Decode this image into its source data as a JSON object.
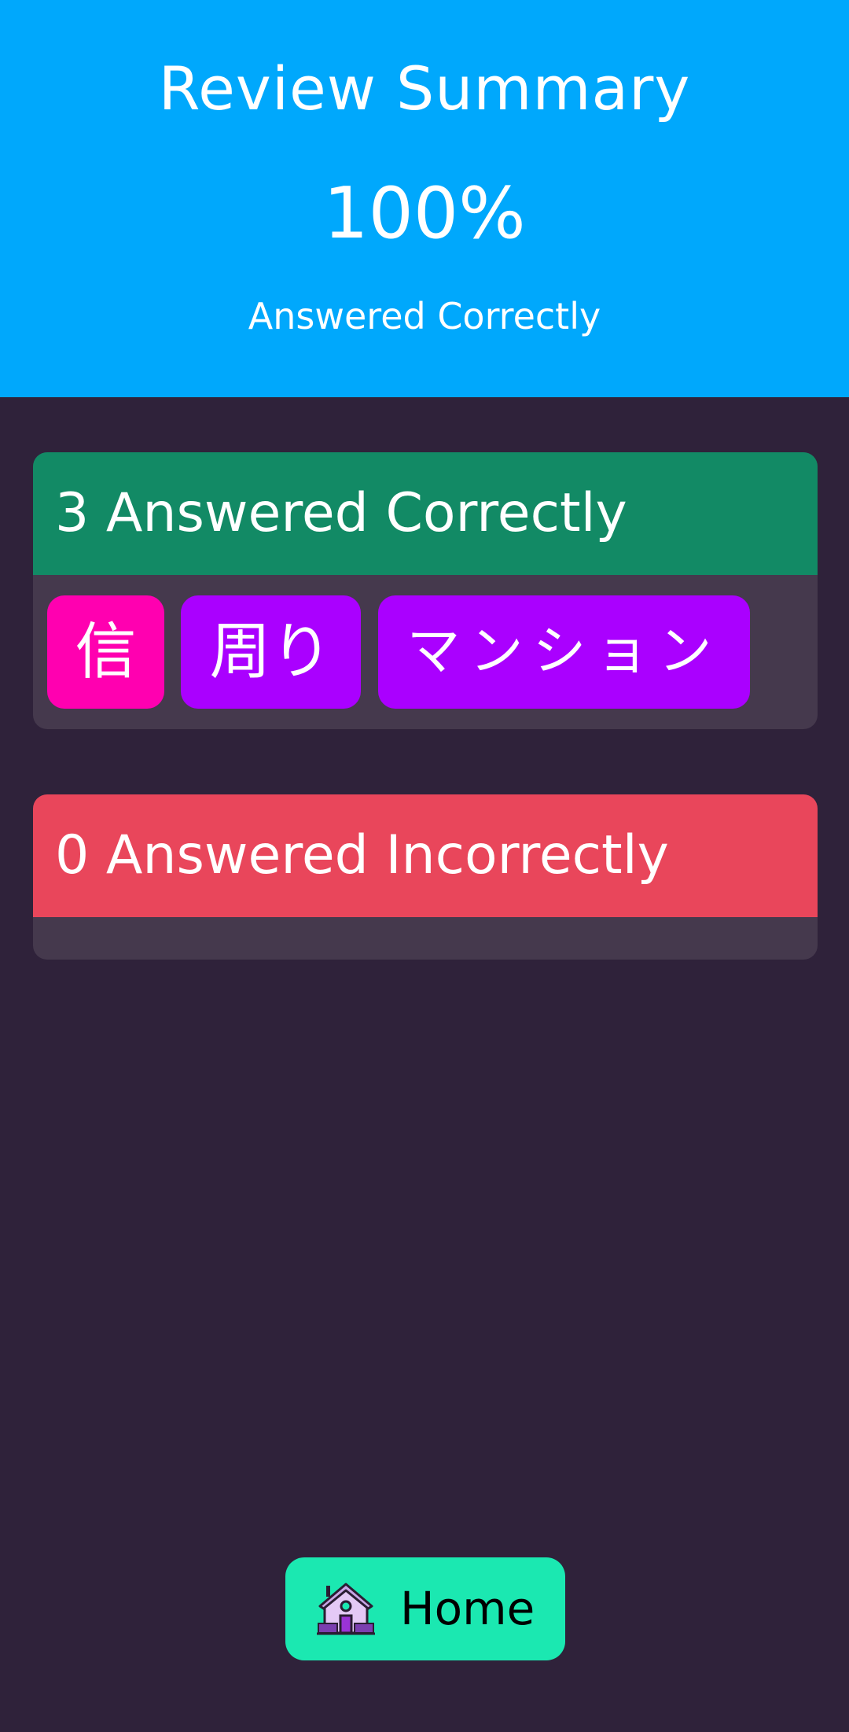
{
  "header": {
    "title": "Review Summary",
    "percent": "100%",
    "subtitle": "Answered Correctly",
    "background_color": "#00a8fc"
  },
  "correct_panel": {
    "title": "3 Answered Correctly",
    "header_color": "#128a65",
    "items": [
      {
        "text": "信",
        "color": "#ff00b0"
      },
      {
        "text": "周り",
        "color": "#aa00ff"
      },
      {
        "text": "マンション",
        "color": "#aa00ff"
      }
    ]
  },
  "incorrect_panel": {
    "title": "0 Answered Incorrectly",
    "header_color": "#e9465b",
    "items": []
  },
  "home_button": {
    "label": "Home",
    "icon": "house-icon",
    "color": "#1be8b1"
  }
}
